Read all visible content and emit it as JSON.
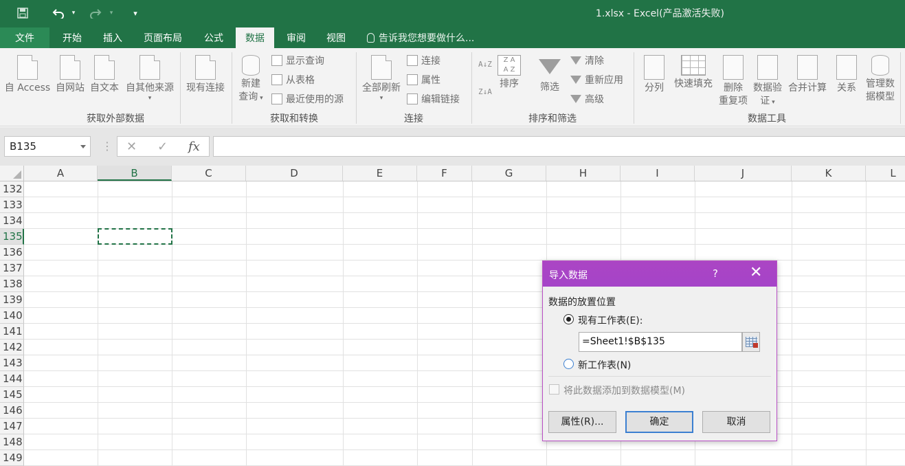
{
  "window": {
    "title": "1.xlsx - Excel(产品激活失败)"
  },
  "quick_access": {
    "save_icon": "save-icon",
    "undo_icon": "undo-icon",
    "redo_icon": "redo-icon",
    "customize_icon": "customize-icon"
  },
  "tabs": [
    {
      "label": "文件"
    },
    {
      "label": "开始"
    },
    {
      "label": "插入"
    },
    {
      "label": "页面布局"
    },
    {
      "label": "公式"
    },
    {
      "label": "数据",
      "active": true
    },
    {
      "label": "审阅"
    },
    {
      "label": "视图"
    }
  ],
  "tell_me": "告诉我您想要做什么...",
  "ribbon": {
    "get_external": {
      "label": "获取外部数据",
      "buttons": [
        "自 Access",
        "自网站",
        "自文本",
        "自其他来源",
        "现有连接"
      ]
    },
    "get_transform": {
      "label": "获取和转换",
      "new_query_line1": "新建",
      "new_query_line2": "查询",
      "small": [
        "显示查询",
        "从表格",
        "最近使用的源"
      ]
    },
    "connections": {
      "label": "连接",
      "refresh_all": "全部刷新",
      "small": [
        "连接",
        "属性",
        "编辑链接"
      ]
    },
    "sort_filter": {
      "label": "排序和筛选",
      "sort": "排序",
      "filter": "筛选",
      "small": [
        "清除",
        "重新应用",
        "高级"
      ],
      "az_up": "A↓Z",
      "za_down": "Z↓A"
    },
    "data_tools": {
      "label": "数据工具",
      "buttons": [
        "分列",
        "快速填充",
        "删除",
        "重复项",
        "数据验",
        "证",
        "合并计算",
        "关系",
        "管理数",
        "据模型"
      ]
    }
  },
  "formula_bar": {
    "name_box": "B135",
    "cancel": "✕",
    "enter": "✓",
    "fx": "fx",
    "formula": ""
  },
  "sheet": {
    "columns": [
      "A",
      "B",
      "C",
      "D",
      "E",
      "F",
      "G",
      "H",
      "I",
      "J",
      "K",
      "L"
    ],
    "selected_column": "B",
    "rows": [
      "132",
      "133",
      "134",
      "135",
      "136",
      "137",
      "138",
      "139",
      "140",
      "141",
      "142",
      "143",
      "144",
      "145",
      "146",
      "147",
      "148",
      "149"
    ],
    "selected_row": "135"
  },
  "dialog": {
    "title": "导入数据",
    "help": "?",
    "close": "✕",
    "section_label": "数据的放置位置",
    "existing_sheet": "现有工作表(E):",
    "range_value": "=Sheet1!$B$135",
    "new_sheet": "新工作表(N)",
    "add_to_model": "将此数据添加到数据模型(M)",
    "properties_btn": "属性(R)...",
    "ok_btn": "确定",
    "cancel_btn": "取消"
  }
}
